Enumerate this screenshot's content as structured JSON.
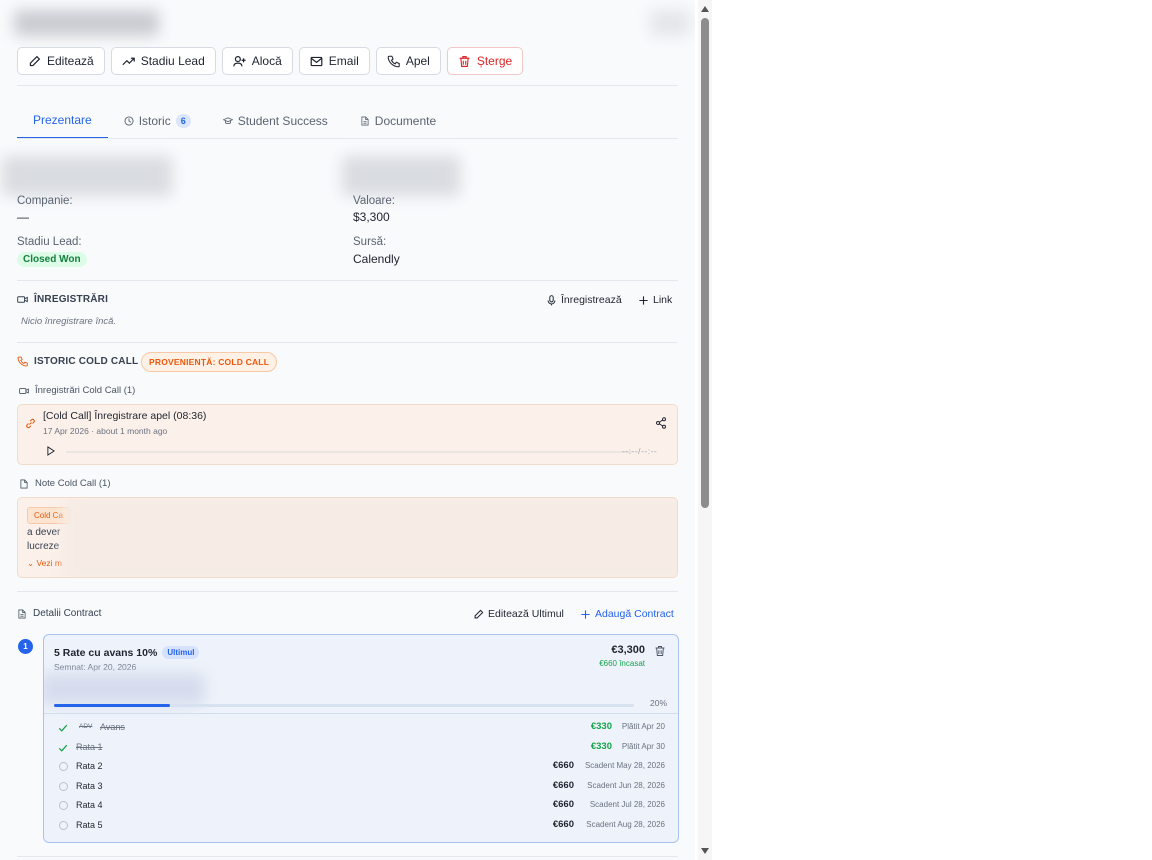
{
  "toolbar": {
    "edit": "Editează",
    "lead_stage": "Stadiu Lead",
    "assign": "Alocă",
    "email": "Email",
    "call": "Apel",
    "delete": "Șterge"
  },
  "tabs": [
    {
      "label": "Prezentare",
      "active": true
    },
    {
      "label": "Istoric",
      "count": "6"
    },
    {
      "label": "Student Success"
    },
    {
      "label": "Documente"
    }
  ],
  "overview": {
    "company_label": "Companie:",
    "company_value": "—",
    "value_label": "Valoare:",
    "value_value": "$3,300",
    "stage_label": "Stadiu Lead:",
    "stage_value": "Closed Won",
    "source_label": "Sursă:",
    "source_value": "Calendly"
  },
  "recordings": {
    "title": "ÎNREGISTRĂRI",
    "record_action": "Înregistrează",
    "link_action": "Link",
    "empty_text": "Nicio înregistrare încă."
  },
  "cold_call": {
    "title": "ISTORIC COLD CALL",
    "origin_badge": "PROVENIENȚĂ: COLD CALL",
    "recordings_subtitle": "Înregistrări Cold Call (1)",
    "recording_title": "[Cold Call] Înregistrare apel (08:36)",
    "recording_date": "17 Apr 2026 · about 1 month ago",
    "player_time": "--:--/--:--",
    "notes_subtitle": "Note Cold Call (1)",
    "note_tag": "Cold Ca",
    "note_line1": "a dever",
    "note_line2": "lucreze",
    "note_more": "Vezi m"
  },
  "contract": {
    "section_title": "Detalii Contract",
    "edit_last": "Editează Ultimul",
    "add_contract": "Adaugă Contract",
    "step": "1",
    "name": "5 Rate cu avans 10%",
    "badge": "Ultimul",
    "signed": "Semnat: Apr 20, 2026",
    "amount": "€3,300",
    "collected": "€660 încasat",
    "progress_percent": 20,
    "progress_label": "20%",
    "installments": [
      {
        "tag": "ADV",
        "name": "Avans",
        "amount": "€330",
        "status": "Plătit Apr 20",
        "paid": true
      },
      {
        "name": "Rata 1",
        "amount": "€330",
        "status": "Plătit Apr 30",
        "paid": true
      },
      {
        "name": "Rata 2",
        "amount": "€660",
        "status": "Scadent May 28, 2026",
        "paid": false
      },
      {
        "name": "Rata 3",
        "amount": "€660",
        "status": "Scadent Jun 28, 2026",
        "paid": false
      },
      {
        "name": "Rata 4",
        "amount": "€660",
        "status": "Scadent Jul 28, 2026",
        "paid": false
      },
      {
        "name": "Rata 5",
        "amount": "€660",
        "status": "Scadent Aug 28, 2026",
        "paid": false
      }
    ]
  },
  "colors": {
    "accent": "#2563eb",
    "success": "#16a34a",
    "danger": "#dc2626",
    "cold_call": "#ea580c"
  }
}
